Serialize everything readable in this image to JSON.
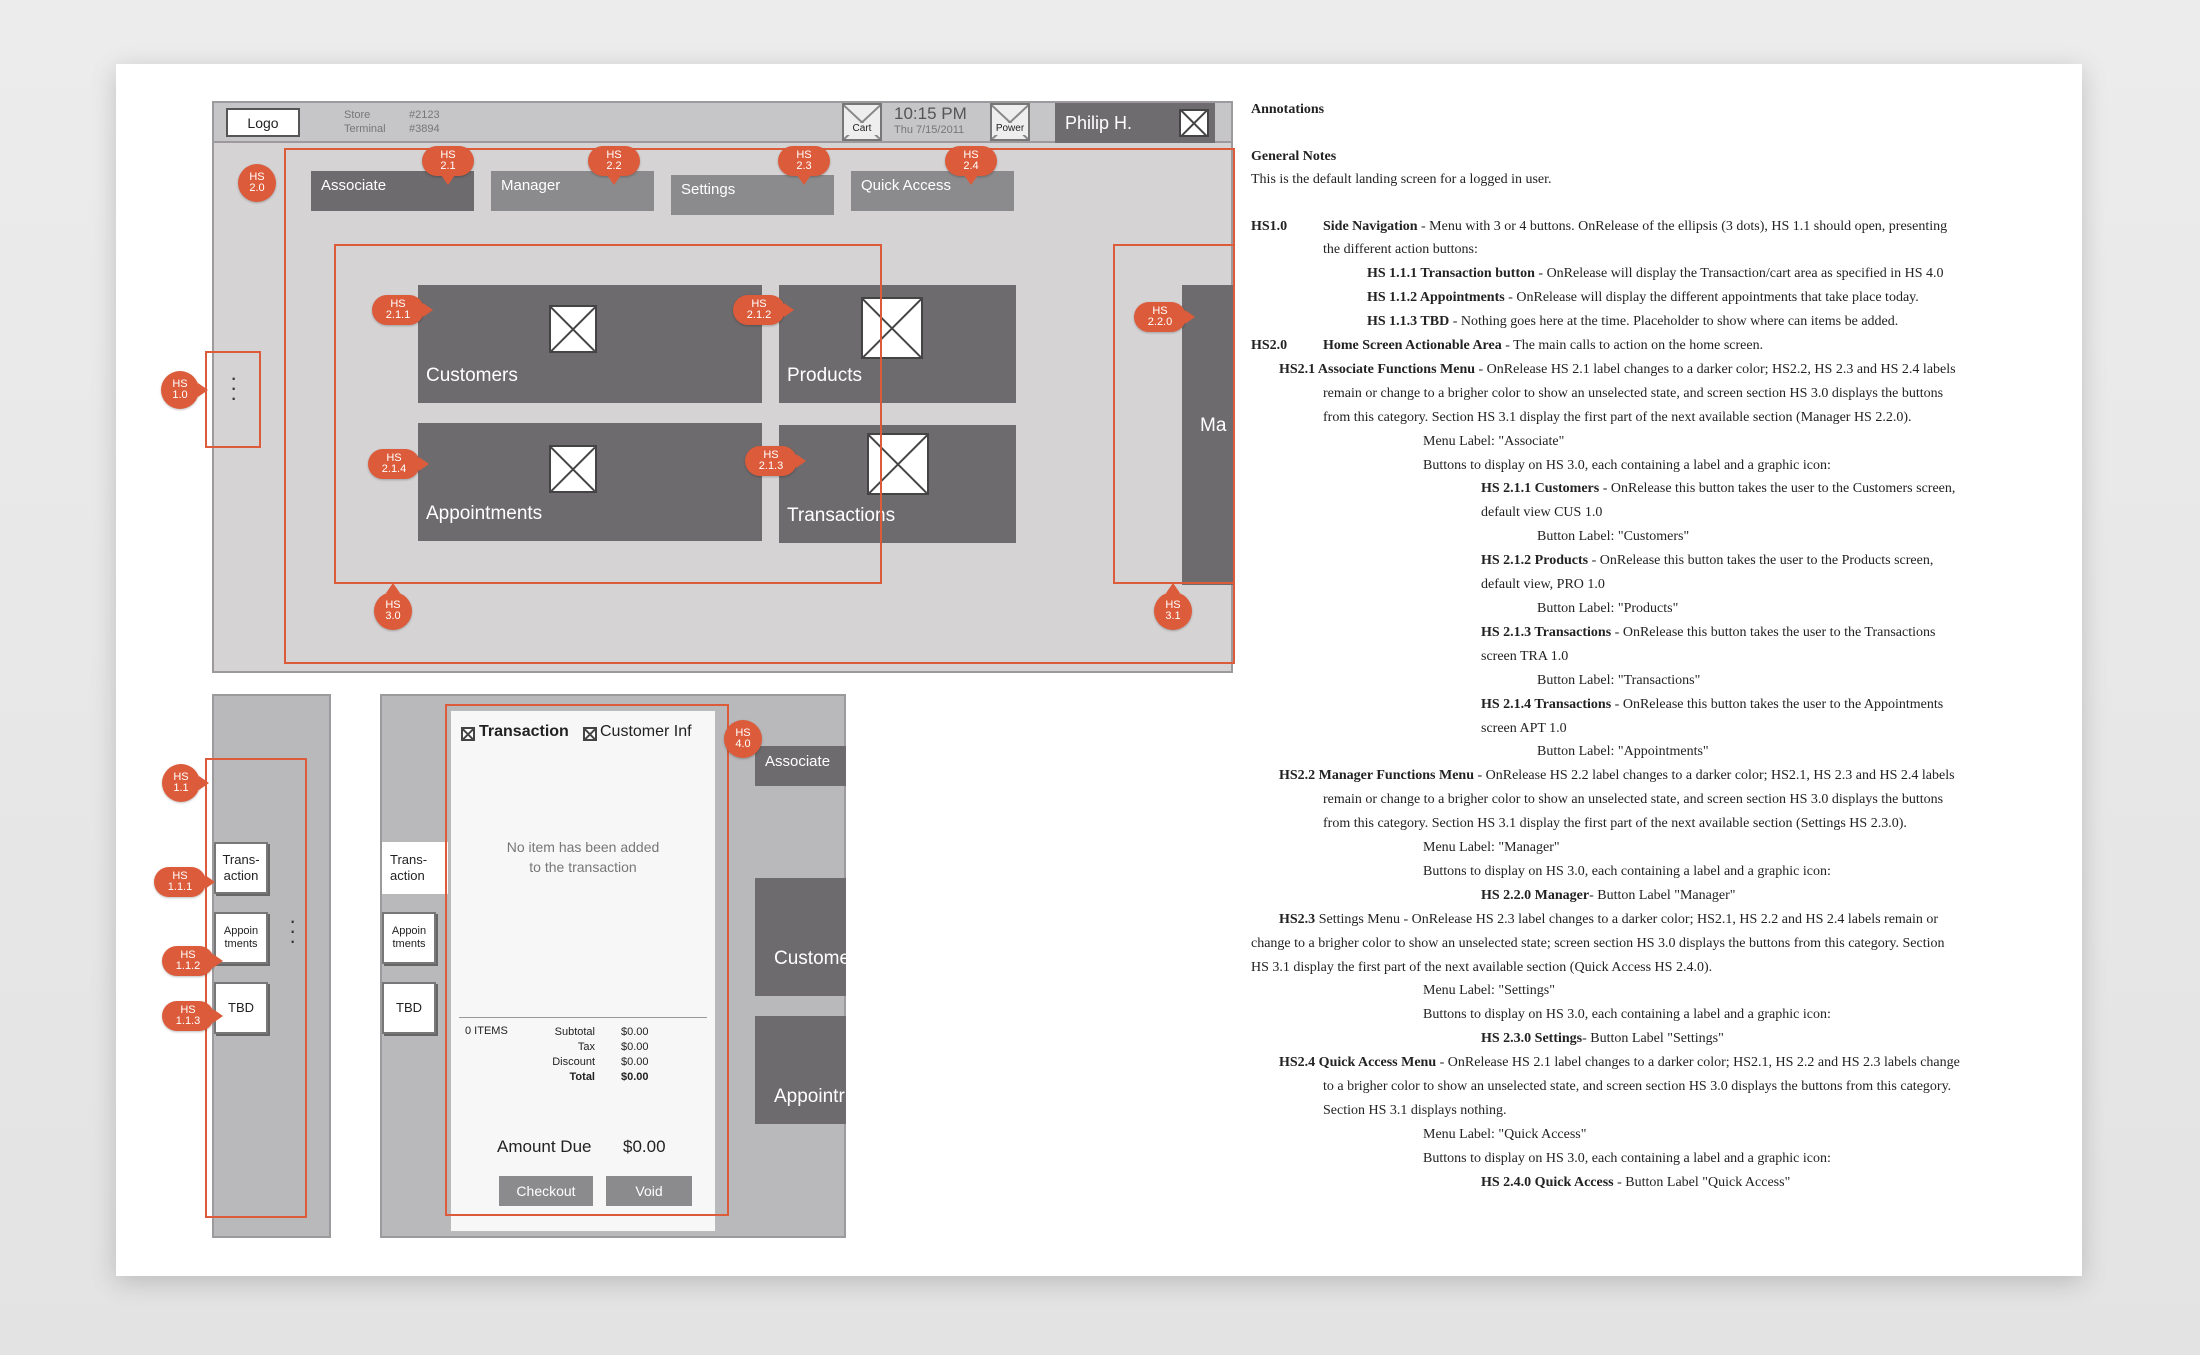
{
  "wireframe": {
    "logo": "Logo",
    "store_label": "Store",
    "store_value": "#2123",
    "terminal_label": "Terminal",
    "terminal_value": "#3894",
    "cart_label": "Cart",
    "time": "10:15 PM",
    "date": "Thu 7/15/2011",
    "power_label": "Power",
    "user_name": "Philip H.",
    "tabs": [
      "Associate",
      "Manager",
      "Settings",
      "Quick Access"
    ],
    "tiles": [
      "Customers",
      "Products",
      "Appointments",
      "Transactions"
    ],
    "next_section_peek": "Ma",
    "pins": {
      "hs10": [
        "HS",
        "1.0"
      ],
      "hs20": [
        "HS",
        "2.0"
      ],
      "hs21": [
        "HS",
        "2.1"
      ],
      "hs22": [
        "HS",
        "2.2"
      ],
      "hs23": [
        "HS",
        "2.3"
      ],
      "hs24": [
        "HS",
        "2.4"
      ],
      "hs211": [
        "HS",
        "2.1.1"
      ],
      "hs212": [
        "HS",
        "2.1.2"
      ],
      "hs213": [
        "HS",
        "2.1.3"
      ],
      "hs214": [
        "HS",
        "2.1.4"
      ],
      "hs220": [
        "HS",
        "2.2.0"
      ],
      "hs30": [
        "HS",
        "3.0"
      ],
      "hs31": [
        "HS",
        "3.1"
      ],
      "hs11": [
        "HS",
        "1.1"
      ],
      "hs111": [
        "HS",
        "1.1.1"
      ],
      "hs112": [
        "HS",
        "1.1.2"
      ],
      "hs113": [
        "HS",
        "1.1.3"
      ],
      "hs40": [
        "HS",
        "4.0"
      ]
    }
  },
  "side_nav": {
    "buttons": [
      "Trans-\naction",
      "Appoin\ntments",
      "TBD"
    ]
  },
  "transaction": {
    "tab_transaction": "Transaction",
    "tab_customer": "Customer Inf",
    "side_label": "Trans-\naction",
    "empty_message": "No item has been added\nto the transaction",
    "items_count": "0 ITEMS",
    "subtotal_label": "Subtotal",
    "subtotal_value": "$0.00",
    "tax_label": "Tax",
    "tax_value": "$0.00",
    "discount_label": "Discount",
    "discount_value": "$0.00",
    "total_label": "Total",
    "total_value": "$0.00",
    "amount_due_label": "Amount Due",
    "amount_due_value": "$0.00",
    "checkout": "Checkout",
    "void": "Void",
    "peek_associate": "Associate",
    "peek_customers": "Custome",
    "peek_appointments": "Appointr"
  },
  "annotations": {
    "title": "Annotations",
    "general_title": "General Notes",
    "general_text": "This is the default landing screen for a logged in user.",
    "lines": [
      {
        "b": "HS1.0",
        "t": ""
      },
      {
        "b": "Side Navigation",
        "t": " - Menu with 3 or 4 buttons. OnRelease of the ellipsis (3 dots), HS 1.1 should open, presenting"
      },
      {
        "b": "",
        "t": "the different action buttons:"
      },
      {
        "b": "HS 1.1.1 Transaction button",
        "t": " - OnRelease will display the Transaction/cart area as specified in HS 4.0"
      },
      {
        "b": "HS 1.1.2 Appointments",
        "t": " - OnRelease will  display the different appointments that take place today."
      },
      {
        "b": "HS 1.1.3 TBD",
        "t": " - Nothing goes here at the time. Placeholder to show where can items be added."
      },
      {
        "b": "HS2.0",
        "t": ""
      },
      {
        "b": "Home Screen Actionable Area",
        "t": " - The main calls to action on the home screen."
      },
      {
        "b": "HS2.1 Associate Functions Menu",
        "t": " - OnRelease HS 2.1 label changes to a darker color; HS2.2, HS 2.3 and HS 2.4 labels"
      },
      {
        "b": "",
        "t": "remain or change to a brigher color to show an unselected state, and screen section HS 3.0 displays the buttons"
      },
      {
        "b": "",
        "t": "from this category. Section HS 3.1 display the first part of the next available section (Manager HS 2.2.0)."
      },
      {
        "b": "",
        "t": "Menu Label: \"Associate\""
      },
      {
        "b": "",
        "t": "Buttons to display on HS 3.0, each containing a label and a graphic icon:"
      },
      {
        "b": "HS 2.1.1 Customers",
        "t": " - OnRelease this button takes the user to the Customers screen,"
      },
      {
        "b": "",
        "t": "default view CUS 1.0"
      },
      {
        "b": "",
        "t": "Button Label: \"Customers\""
      },
      {
        "b": "HS 2.1.2 Products",
        "t": " - OnRelease this button takes the user to the Products screen,"
      },
      {
        "b": "",
        "t": "default view, PRO 1.0"
      },
      {
        "b": "",
        "t": "Button Label: \"Products\""
      },
      {
        "b": "HS 2.1.3 Transactions",
        "t": " - OnRelease this button takes the user to the Transactions"
      },
      {
        "b": "",
        "t": "screen TRA 1.0"
      },
      {
        "b": "",
        "t": "Button Label: \"Transactions\""
      },
      {
        "b": "HS 2.1.4 Transactions",
        "t": " - OnRelease this button takes the user to the Appointments"
      },
      {
        "b": "",
        "t": "screen APT 1.0"
      },
      {
        "b": "",
        "t": "Button Label: \"Appointments\""
      },
      {
        "b": "HS2.2 Manager Functions Menu",
        "t": " - OnRelease HS 2.2 label changes to a darker color; HS2.1, HS 2.3 and HS 2.4 labels"
      },
      {
        "b": "",
        "t": "remain or change to a brigher color to show an unselected state, and screen section HS 3.0 displays the buttons"
      },
      {
        "b": "",
        "t": "from this category. Section HS 3.1 display the first part of the next available section (Settings HS 2.3.0)."
      },
      {
        "b": "",
        "t": "Menu Label: \"Manager\""
      },
      {
        "b": "",
        "t": "Buttons to display on HS 3.0, each containing a label and a graphic icon:"
      },
      {
        "b": "HS 2.2.0 Manager",
        "t": "- Button Label \"Manager\""
      },
      {
        "b": "HS2.3",
        "t": " Settings Menu -  OnRelease HS 2.3 label changes to a darker color; HS2.1, HS 2.2 and HS 2.4 labels remain or"
      },
      {
        "b": "",
        "t": "change to a brigher color to show an unselected state; screen section HS 3.0 displays the buttons from this category. Section"
      },
      {
        "b": "",
        "t": "HS 3.1 display the first part of the next available section (Quick Access HS 2.4.0)."
      },
      {
        "b": "",
        "t": "Menu Label: \"Settings\""
      },
      {
        "b": "",
        "t": "Buttons to display on HS 3.0, each containing a label and a graphic icon:"
      },
      {
        "b": "HS 2.3.0 Settings",
        "t": "- Button Label \"Settings\""
      },
      {
        "b": "HS2.4 Quick Access Menu",
        "t": " -  OnRelease HS 2.1 label changes to a darker color; HS2.1, HS 2.2 and HS 2.3 labels change"
      },
      {
        "b": "",
        "t": "to a brigher color to show an unselected state, and screen section HS 3.0 displays the buttons from this category."
      },
      {
        "b": "",
        "t": "Section HS 3.1 displays nothing."
      },
      {
        "b": "",
        "t": "Menu Label: \"Quick Access\""
      },
      {
        "b": "",
        "t": "Buttons to display on HS 3.0, each containing a label and a graphic icon:"
      },
      {
        "b": "HS 2.4.0 Quick Access",
        "t": " - Button Label \"Quick Access\""
      }
    ]
  }
}
